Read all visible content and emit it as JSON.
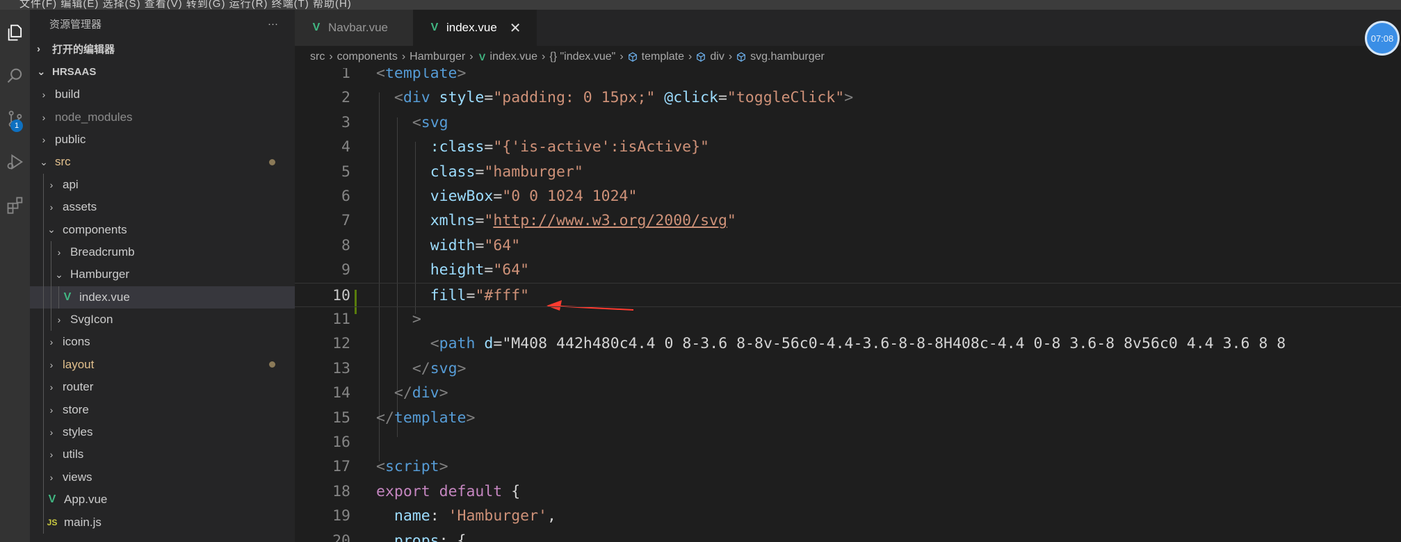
{
  "menu_text": "文件(F)  编辑(E)  选择(S)  查看(V)  转到(G)  运行(R)  终端(T)  帮助(H)",
  "activity": {
    "scm_badge": "1"
  },
  "sidebar": {
    "title": "资源管理器",
    "more": "···",
    "open_editors": "打开的编辑器",
    "root": "HRSAAS",
    "tree": [
      {
        "label": "build",
        "type": "folder",
        "open": false,
        "depth": 1
      },
      {
        "label": "node_modules",
        "type": "folder",
        "open": false,
        "depth": 1,
        "dim": true
      },
      {
        "label": "public",
        "type": "folder",
        "open": false,
        "depth": 1
      },
      {
        "label": "src",
        "type": "folder",
        "open": true,
        "depth": 1,
        "mod": true
      },
      {
        "label": "api",
        "type": "folder",
        "open": false,
        "depth": 2
      },
      {
        "label": "assets",
        "type": "folder",
        "open": false,
        "depth": 2
      },
      {
        "label": "components",
        "type": "folder",
        "open": true,
        "depth": 2
      },
      {
        "label": "Breadcrumb",
        "type": "folder",
        "open": false,
        "depth": 3
      },
      {
        "label": "Hamburger",
        "type": "folder",
        "open": true,
        "depth": 3
      },
      {
        "label": "index.vue",
        "type": "vue",
        "depth": 4,
        "selected": true
      },
      {
        "label": "SvgIcon",
        "type": "folder",
        "open": false,
        "depth": 3
      },
      {
        "label": "icons",
        "type": "folder",
        "open": false,
        "depth": 2
      },
      {
        "label": "layout",
        "type": "folder",
        "open": false,
        "depth": 2,
        "mod": true
      },
      {
        "label": "router",
        "type": "folder",
        "open": false,
        "depth": 2
      },
      {
        "label": "store",
        "type": "folder",
        "open": false,
        "depth": 2
      },
      {
        "label": "styles",
        "type": "folder",
        "open": false,
        "depth": 2
      },
      {
        "label": "utils",
        "type": "folder",
        "open": false,
        "depth": 2
      },
      {
        "label": "views",
        "type": "folder",
        "open": false,
        "depth": 2
      },
      {
        "label": "App.vue",
        "type": "vue",
        "depth": 2
      },
      {
        "label": "main.js",
        "type": "js",
        "depth": 2
      }
    ]
  },
  "tabs": [
    {
      "label": "Navbar.vue",
      "active": false
    },
    {
      "label": "index.vue",
      "active": true,
      "close": "✕"
    }
  ],
  "clock": "07:08",
  "breadcrumb": {
    "items": [
      "src",
      "components",
      "Hamburger",
      "index.vue",
      "{} \"index.vue\"",
      "template",
      "div",
      "svg.hamburger"
    ]
  },
  "editor": {
    "lines": [
      "<template>",
      "  <div style=\"padding: 0 15px;\" @click=\"toggleClick\">",
      "    <svg",
      "      :class=\"{'is-active':isActive}\"",
      "      class=\"hamburger\"",
      "      viewBox=\"0 0 1024 1024\"",
      "      xmlns=\"http://www.w3.org/2000/svg\"",
      "      width=\"64\"",
      "      height=\"64\"",
      "      fill=\"#fff\"",
      "    >",
      "      <path d=\"M408 442h480c4.4 0 8-3.6 8-8v-56c0-4.4-3.6-8-8-8H408c-4.4 0-8 3.6-8 8v56c0 4.4 3.6 8 8",
      "    </svg>",
      "  </div>",
      "</template>",
      "",
      "<script>",
      "export default {",
      "  name: 'Hamburger',",
      "  props: {"
    ],
    "current_line": 10
  }
}
